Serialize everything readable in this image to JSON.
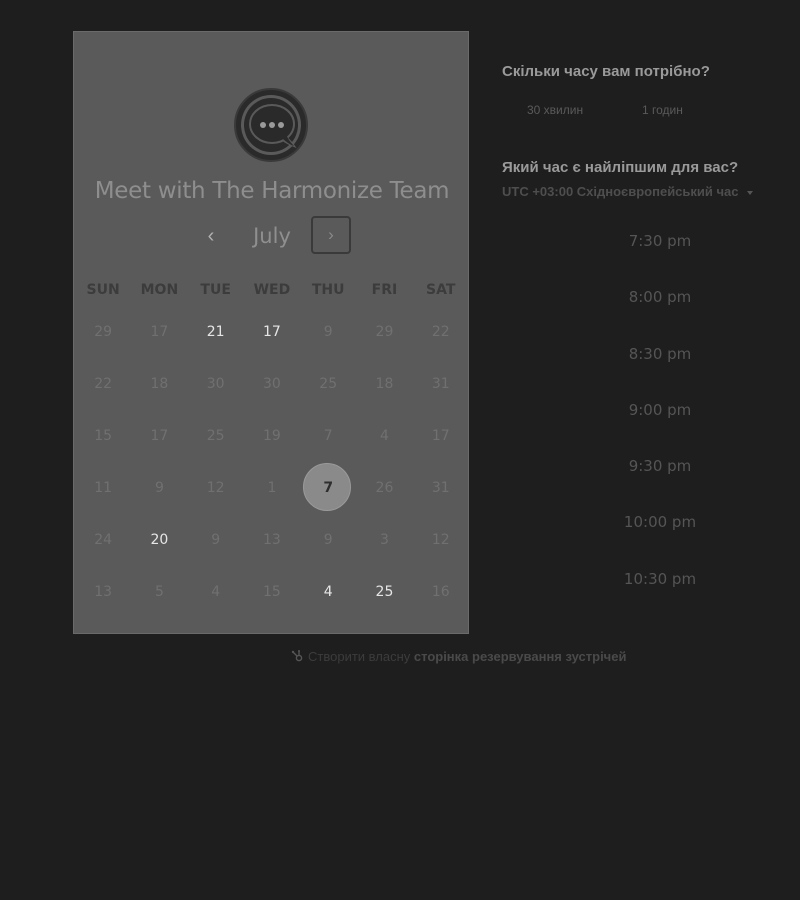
{
  "calendar": {
    "title": "Meet with The Harmonize Team",
    "month": "July",
    "prev_glyph": "‹",
    "next_glyph": "›",
    "weekdays": [
      "SUN",
      "MON",
      "TUE",
      "WED",
      "THU",
      "FRI",
      "SAT"
    ],
    "weeks": [
      [
        {
          "d": "29",
          "a": false
        },
        {
          "d": "17",
          "a": false
        },
        {
          "d": "21",
          "a": true
        },
        {
          "d": "17",
          "a": true
        },
        {
          "d": "9",
          "a": false
        },
        {
          "d": "29",
          "a": false
        },
        {
          "d": "22",
          "a": false
        }
      ],
      [
        {
          "d": "22",
          "a": false
        },
        {
          "d": "18",
          "a": false
        },
        {
          "d": "30",
          "a": false
        },
        {
          "d": "30",
          "a": false
        },
        {
          "d": "25",
          "a": false
        },
        {
          "d": "18",
          "a": false
        },
        {
          "d": "31",
          "a": false
        }
      ],
      [
        {
          "d": "15",
          "a": false
        },
        {
          "d": "17",
          "a": false
        },
        {
          "d": "25",
          "a": false
        },
        {
          "d": "19",
          "a": false
        },
        {
          "d": "7",
          "a": false
        },
        {
          "d": "4",
          "a": false
        },
        {
          "d": "17",
          "a": false
        }
      ],
      [
        {
          "d": "11",
          "a": false
        },
        {
          "d": "9",
          "a": false
        },
        {
          "d": "12",
          "a": false
        },
        {
          "d": "1",
          "a": false
        },
        {
          "d": "7",
          "a": true,
          "selected": true
        },
        {
          "d": "26",
          "a": false
        },
        {
          "d": "31",
          "a": false
        }
      ],
      [
        {
          "d": "24",
          "a": false
        },
        {
          "d": "20",
          "a": true
        },
        {
          "d": "9",
          "a": false
        },
        {
          "d": "13",
          "a": false
        },
        {
          "d": "9",
          "a": false
        },
        {
          "d": "3",
          "a": false
        },
        {
          "d": "12",
          "a": false
        }
      ],
      [
        {
          "d": "13",
          "a": false
        },
        {
          "d": "5",
          "a": false
        },
        {
          "d": "4",
          "a": false
        },
        {
          "d": "15",
          "a": false
        },
        {
          "d": "4",
          "a": true
        },
        {
          "d": "25",
          "a": true
        },
        {
          "d": "16",
          "a": false
        }
      ]
    ]
  },
  "duration": {
    "question": "Скільки часу вам потрібно?",
    "options": [
      "30 хвилин",
      "1 годин"
    ]
  },
  "best_time": {
    "question": "Який час є найліпшим для вас?",
    "timezone": "UTC +03:00 Східноєвропейський час"
  },
  "slots": [
    "7:30 pm",
    "8:00 pm",
    "8:30 pm",
    "9:00 pm",
    "9:30 pm",
    "10:00 pm",
    "10:30 pm"
  ],
  "footer": {
    "prefix": "Створити власну",
    "link": "сторінка резервування зустрічей"
  },
  "icons": {
    "logo": "chat-bubble-icon",
    "footer": "hubspot-sprocket-icon"
  }
}
